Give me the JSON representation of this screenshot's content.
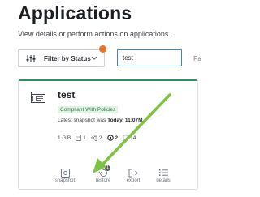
{
  "page": {
    "title": "Applications",
    "subtitle": "View details or perform actions on applications."
  },
  "toolbar": {
    "filter_label": "Filter by Status",
    "filter_icon": "filter-icon",
    "search_value": "test",
    "page_label": "Pa"
  },
  "card": {
    "name": "test",
    "badge": "Compliant With Policies",
    "snapshot_label": "Latest snapshot was",
    "snapshot_value": "Today, 11:07",
    "snapshot_suffix": "M",
    "stats": [
      {
        "icon": "storage-icon",
        "value": "1 GiB"
      },
      {
        "icon": "volume-icon",
        "value": "1"
      },
      {
        "icon": "share-icon",
        "value": "2"
      },
      {
        "icon": "policy-icon",
        "value": "2"
      },
      {
        "icon": "resource-icon",
        "value": "14"
      }
    ],
    "actions": [
      {
        "icon": "snapshot-icon",
        "label": "snapshot"
      },
      {
        "icon": "restore-icon",
        "label": "restore",
        "count": "1"
      },
      {
        "icon": "export-icon",
        "label": "export"
      },
      {
        "icon": "details-icon",
        "label": "details"
      }
    ]
  },
  "colors": {
    "accent_green": "#2f8f5a",
    "badge_bg": "#e2f3e6",
    "notification_orange": "#e8722c",
    "input_border": "#3b86c6",
    "annotation_arrow": "#7cc243"
  }
}
